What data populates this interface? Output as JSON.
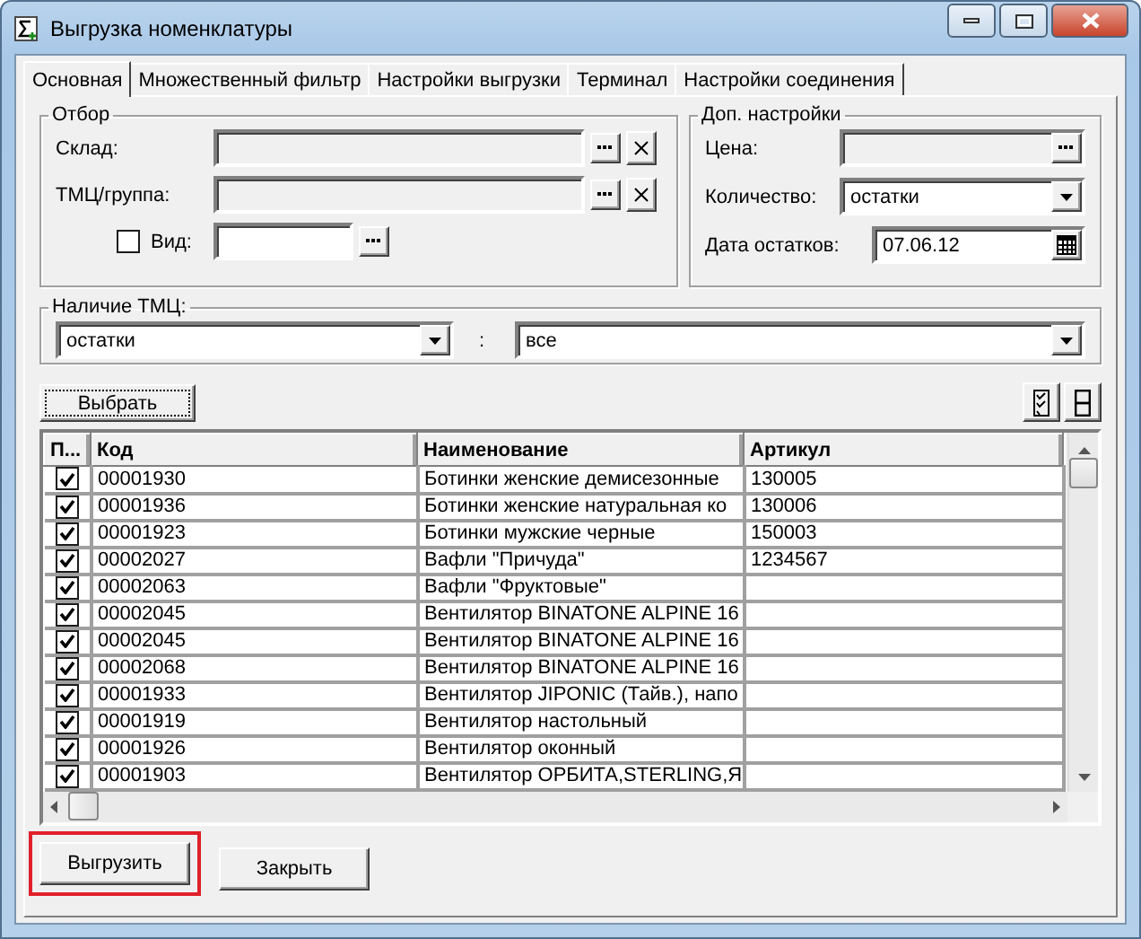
{
  "window": {
    "title": "Выгрузка номенклатуры"
  },
  "tabs": [
    {
      "label": "Основная",
      "selected": true
    },
    {
      "label": "Множественный фильтр",
      "selected": false
    },
    {
      "label": "Настройки выгрузки",
      "selected": false
    },
    {
      "label": "Терминал",
      "selected": false
    },
    {
      "label": "Настройки соединения",
      "selected": false
    }
  ],
  "filter": {
    "title": "Отбор",
    "warehouse": {
      "label": "Склад:"
    },
    "goods_group": {
      "label": "ТМЦ/группа:"
    },
    "view": {
      "label": "Вид:",
      "checked": false
    }
  },
  "extra": {
    "title": "Доп. настройки",
    "price": {
      "label": "Цена:"
    },
    "quantity": {
      "label": "Количество:",
      "value": "остатки"
    },
    "stock_date": {
      "label": "Дата остатков:",
      "value": "07.06.12"
    }
  },
  "availability": {
    "title": "Наличие ТМЦ:",
    "left": "остатки",
    "separator": ":",
    "right": "все"
  },
  "select_button": "Выбрать",
  "table": {
    "columns": [
      "П...",
      "Код",
      "Наименование",
      "Артикул"
    ],
    "rows": [
      {
        "checked": true,
        "code": "00001930",
        "name": "Ботинки женские демисезонные",
        "article": "130005"
      },
      {
        "checked": true,
        "code": "00001936",
        "name": "Ботинки женские натуральная ко",
        "article": "130006"
      },
      {
        "checked": true,
        "code": "00001923",
        "name": "Ботинки мужские черные",
        "article": "150003"
      },
      {
        "checked": true,
        "code": "00002027",
        "name": "Вафли \"Причуда\"",
        "article": "1234567"
      },
      {
        "checked": true,
        "code": "00002063",
        "name": "Вафли \"Фруктовые\"",
        "article": ""
      },
      {
        "checked": true,
        "code": "00002045",
        "name": "Вентилятор BINATONE ALPINE 16",
        "article": ""
      },
      {
        "checked": true,
        "code": "00002045",
        "name": "Вентилятор BINATONE ALPINE 16",
        "article": ""
      },
      {
        "checked": true,
        "code": "00002068",
        "name": "Вентилятор BINATONE ALPINE 16",
        "article": ""
      },
      {
        "checked": true,
        "code": "00001933",
        "name": "Вентилятор JIPONIC (Тайв.), напо",
        "article": ""
      },
      {
        "checked": true,
        "code": "00001919",
        "name": "Вентилятор настольный",
        "article": ""
      },
      {
        "checked": true,
        "code": "00001926",
        "name": "Вентилятор оконный",
        "article": ""
      },
      {
        "checked": true,
        "code": "00001903",
        "name": "Вентилятор ОРБИТА,STERLING,Я",
        "article": ""
      }
    ]
  },
  "buttons": [
    {
      "label": "Выгрузить",
      "highlighted": true
    },
    {
      "label": "Закрыть",
      "highlighted": false
    }
  ]
}
